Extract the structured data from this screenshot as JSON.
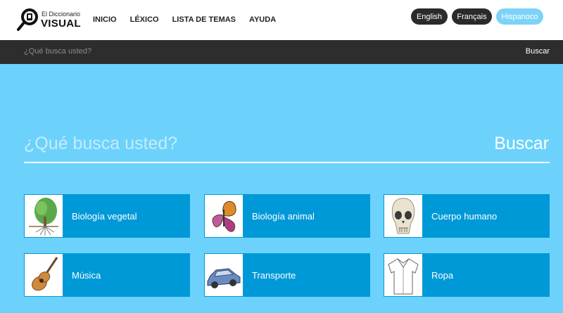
{
  "logo": {
    "small": "El Diccionario",
    "big": "VISUAL"
  },
  "nav": [
    "INICIO",
    "LÉXICO",
    "LISTA DE TEMAS",
    "AYUDA"
  ],
  "languages": {
    "en": "English",
    "fr": "Français",
    "es": "Hispanoco"
  },
  "topbar": {
    "placeholder": "¿Qué busca usted?",
    "button": "Buscar"
  },
  "hero": {
    "placeholder": "¿Qué busca usted?",
    "button": "Buscar"
  },
  "categories": [
    {
      "label": "Biología vegetal",
      "icon": "tree-icon"
    },
    {
      "label": "Biología animal",
      "icon": "butterfly-icon"
    },
    {
      "label": "Cuerpo humano",
      "icon": "skull-icon"
    },
    {
      "label": "Música",
      "icon": "guitar-icon"
    },
    {
      "label": "Transporte",
      "icon": "car-icon"
    },
    {
      "label": "Ropa",
      "icon": "shirt-icon"
    }
  ],
  "colors": {
    "background": "#6cd2fc",
    "card": "#0099d8",
    "topbar": "#2d2d2d",
    "active_lang": "#7dd3f7"
  }
}
